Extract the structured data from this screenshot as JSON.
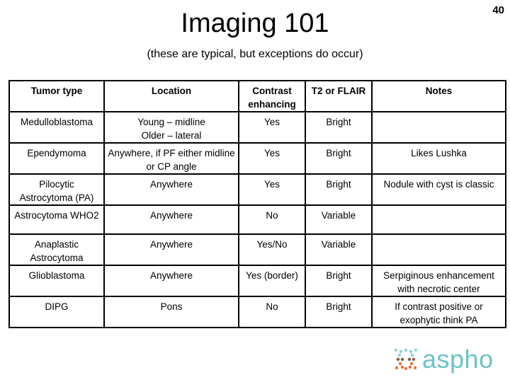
{
  "slide_number": "40",
  "title": "Imaging 101",
  "subtitle": "(these are typical, but exceptions do occur)",
  "table": {
    "headers": [
      "Tumor type",
      "Location",
      "Contrast enhancing",
      "T2 or FLAIR",
      "Notes"
    ],
    "rows": [
      [
        "Medulloblastoma",
        "Young – midline\nOlder – lateral",
        "Yes",
        "Bright",
        ""
      ],
      [
        "Ependymoma",
        "Anywhere, if PF either midline or CP angle",
        "Yes",
        "Bright",
        "Likes Lushka"
      ],
      [
        "Pilocytic Astrocytoma (PA)",
        "Anywhere",
        "Yes",
        "Bright",
        "Nodule with cyst is classic"
      ],
      [
        "Astrocytoma WHO2",
        "Anywhere",
        "No",
        "Variable",
        ""
      ],
      [
        "Anaplastic Astrocytoma",
        "Anywhere",
        "Yes/No",
        "Variable",
        ""
      ],
      [
        "Glioblastoma",
        "Anywhere",
        "Yes (border)",
        "Bright",
        "Serpiginous enhancement with necrotic center"
      ],
      [
        "DIPG",
        "Pons",
        "No",
        "Bright",
        "If contrast positive or exophytic think PA"
      ]
    ]
  },
  "logo": {
    "text": "aspho",
    "icon": "dots-x-icon",
    "colors": {
      "text": "#6cc3c6",
      "dots_top": "#8fd3d6",
      "dots_mid": "#8a5a44",
      "dots_bottom": "#e8733a"
    }
  }
}
